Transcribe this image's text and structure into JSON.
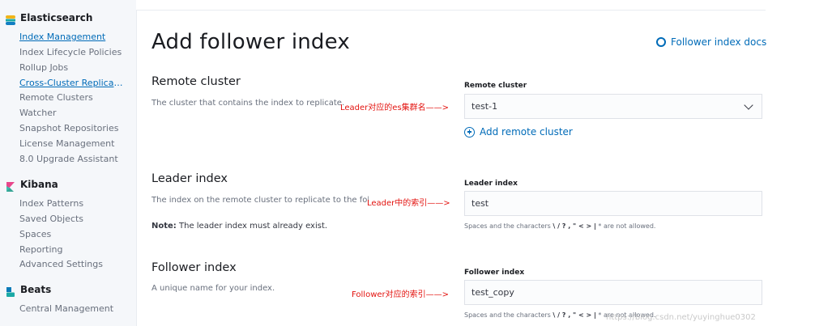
{
  "sidebar": {
    "elasticsearch": {
      "title": "Elasticsearch",
      "items": [
        "Index Management",
        "Index Lifecycle Policies",
        "Rollup Jobs",
        "Cross-Cluster Replicati...",
        "Remote Clusters",
        "Watcher",
        "Snapshot Repositories",
        "License Management",
        "8.0 Upgrade Assistant"
      ]
    },
    "kibana": {
      "title": "Kibana",
      "items": [
        "Index Patterns",
        "Saved Objects",
        "Spaces",
        "Reporting",
        "Advanced Settings"
      ]
    },
    "beats": {
      "title": "Beats",
      "items": [
        "Central Management"
      ]
    }
  },
  "page": {
    "title": "Add follower index",
    "docs_link": "Follower index docs"
  },
  "remote_cluster": {
    "title": "Remote cluster",
    "description": "The cluster that contains the index to replicate.",
    "label": "Remote cluster",
    "value": "test-1",
    "add_link": "Add remote cluster",
    "annotation": "Leader对应的es集群名——>"
  },
  "leader_index": {
    "title": "Leader index",
    "description": "The index on the remote cluster to replicate to the follower index.",
    "note_prefix": "Note:",
    "note_text": " The leader index must already exist.",
    "label": "Leader index",
    "value": "test",
    "help_prefix": "Spaces and the characters ",
    "help_chars": "\\ / ? , \" < > |",
    "help_star": " * ",
    "help_suffix": "are not allowed.",
    "annotation": "Leader中的索引——>"
  },
  "follower_index": {
    "title": "Follower index",
    "description": "A unique name for your index.",
    "label": "Follower index",
    "value": "test_copy",
    "help_prefix": "Spaces and the characters ",
    "help_chars": "\\ / ? , \" < > |",
    "help_star": " * ",
    "help_suffix": "are not allowed.",
    "annotation": "Follower对应的索引——>"
  },
  "watermark": "https://blog.csdn.net/yuyinghue0302",
  "colors": {
    "link": "#006bb8",
    "annotation": "#e3130f",
    "sidebar_bg": "#f5f7fa"
  }
}
